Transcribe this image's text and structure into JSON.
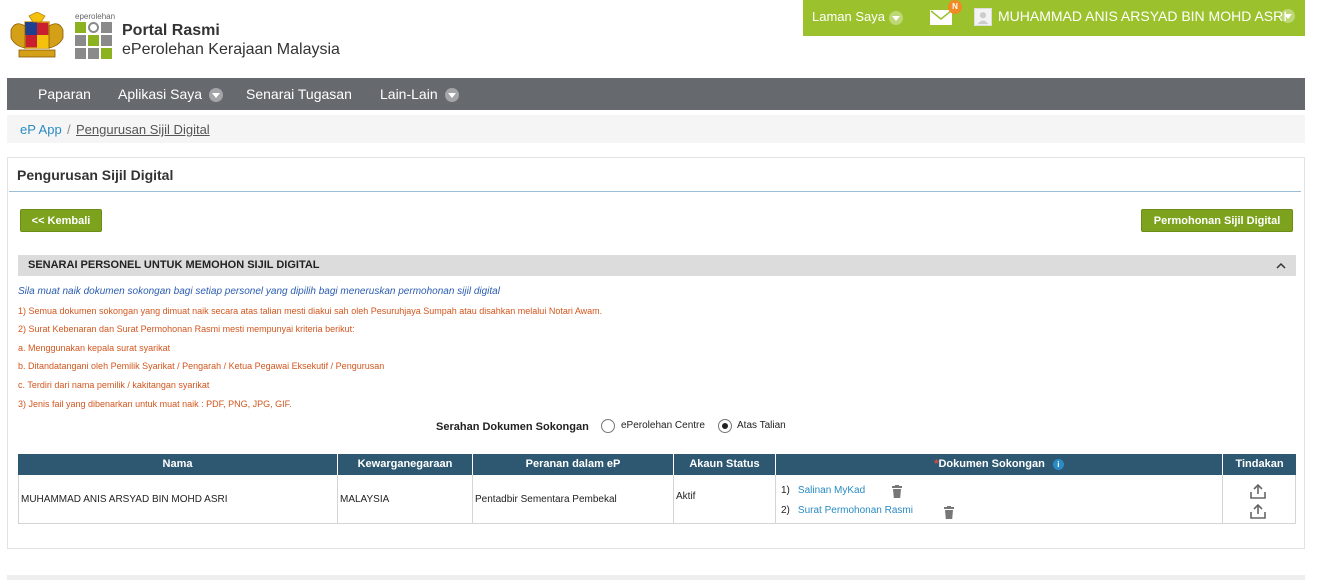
{
  "header": {
    "logo_small_text": "eperolehan",
    "title": "Portal Rasmi",
    "subtitle": "ePerolehan Kerajaan Malaysia"
  },
  "userbar": {
    "laman_saya": "Laman Saya",
    "notification_badge": "N",
    "user_name": "MUHAMMAD ANIS ARSYAD BIN MOHD ASRI",
    "bg_color": "#9bc22c"
  },
  "nav": {
    "items": [
      {
        "label": "Paparan",
        "dropdown": false
      },
      {
        "label": "Aplikasi Saya",
        "dropdown": true
      },
      {
        "label": "Senarai Tugasan",
        "dropdown": false
      },
      {
        "label": "Lain-Lain",
        "dropdown": true
      }
    ]
  },
  "breadcrumb": {
    "home": "eP App",
    "separator": "/",
    "current": "Pengurusan Sijil Digital"
  },
  "panel": {
    "title": "Pengurusan Sijil Digital",
    "back_button": "<< Kembali",
    "apply_button": "Permohonan Sijil Digital",
    "section_title": "SENARAI PERSONEL UNTUK MEMOHON SIJIL DIGITAL",
    "intro": "Sila muat naik dokumen sokongan bagi setiap personel yang dipilih bagi meneruskan permohonan sijil digital",
    "notes": [
      "1) Semua dokumen sokongan yang dimuat naik secara atas talian mesti diakui sah oleh Pesuruhjaya Sumpah atau disahkan melalui Notari Awam.",
      "2) Surat Kebenaran dan Surat Permohonan Rasmi mesti mempunyai kriteria berikut:",
      "a. Menggunakan kepala surat syarikat",
      "b. Ditandatangani oleh Pemilik Syarikat / Pengarah / Ketua Pegawai Eksekutif / Pengurusan",
      "c. Terdiri dari nama pemilik / kakitangan syarikat",
      "3) Jenis fail yang dibenarkan untuk muat naik : PDF, PNG, JPG, GIF."
    ],
    "serahan": {
      "label": "Serahan Dokumen Sokongan",
      "options": [
        {
          "label": "ePerolehan Centre",
          "selected": false
        },
        {
          "label": "Atas Talian",
          "selected": true
        }
      ]
    }
  },
  "table": {
    "headers": {
      "nama": "Nama",
      "kewarganegaraan": "Kewarganegaraan",
      "peranan": "Peranan dalam eP",
      "akaun_status": "Akaun Status",
      "dokumen_required_mark": "*",
      "dokumen": "Dokumen Sokongan",
      "tindakan": "Tindakan"
    },
    "rows": [
      {
        "nama": "MUHAMMAD ANIS ARSYAD BIN MOHD ASRI",
        "kewarganegaraan": "MALAYSIA",
        "peranan": "Pentadbir Sementara Pembekal",
        "akaun_status": "Aktif",
        "documents": [
          {
            "num": "1)",
            "name": "Salinan MyKad"
          },
          {
            "num": "2)",
            "name": "Surat Permohonan Rasmi"
          }
        ]
      }
    ]
  }
}
